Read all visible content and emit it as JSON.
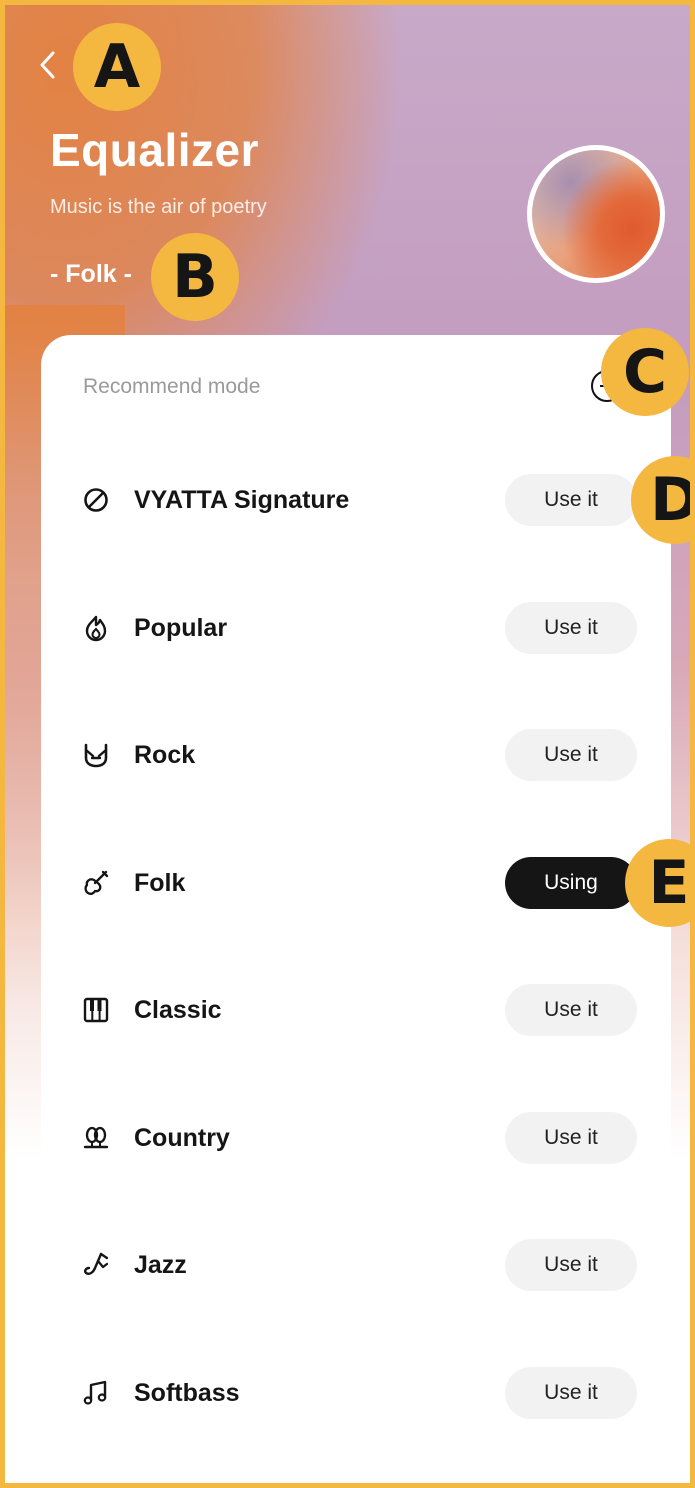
{
  "header": {
    "title": "Equalizer",
    "subtitle": "Music is the air of poetry",
    "current_mode": "- Folk -"
  },
  "annotations": [
    "A",
    "B",
    "C",
    "D",
    "E"
  ],
  "card": {
    "header_label": "Recommend mode",
    "modes": [
      {
        "label": "VYATTA Signature",
        "icon": "prohibited-circle-icon",
        "button": "Use it",
        "active": false
      },
      {
        "label": "Popular",
        "icon": "flame-icon",
        "button": "Use it",
        "active": false
      },
      {
        "label": "Rock",
        "icon": "rock-hand-icon",
        "button": "Use it",
        "active": false
      },
      {
        "label": "Folk",
        "icon": "guitar-icon",
        "button": "Using",
        "active": true
      },
      {
        "label": "Classic",
        "icon": "piano-keys-icon",
        "button": "Use it",
        "active": false
      },
      {
        "label": "Country",
        "icon": "country-icon",
        "button": "Use it",
        "active": false
      },
      {
        "label": "Jazz",
        "icon": "saxophone-icon",
        "button": "Use it",
        "active": false
      },
      {
        "label": "Softbass",
        "icon": "music-note-icon",
        "button": "Use it",
        "active": false
      }
    ]
  },
  "colors": {
    "badge": "#f4b740",
    "frame_border": "#f4b740",
    "accent_orange": "#e4803c",
    "accent_mauve": "#c39cbf",
    "active_button": "#151515",
    "inactive_button": "#f2f2f2"
  }
}
